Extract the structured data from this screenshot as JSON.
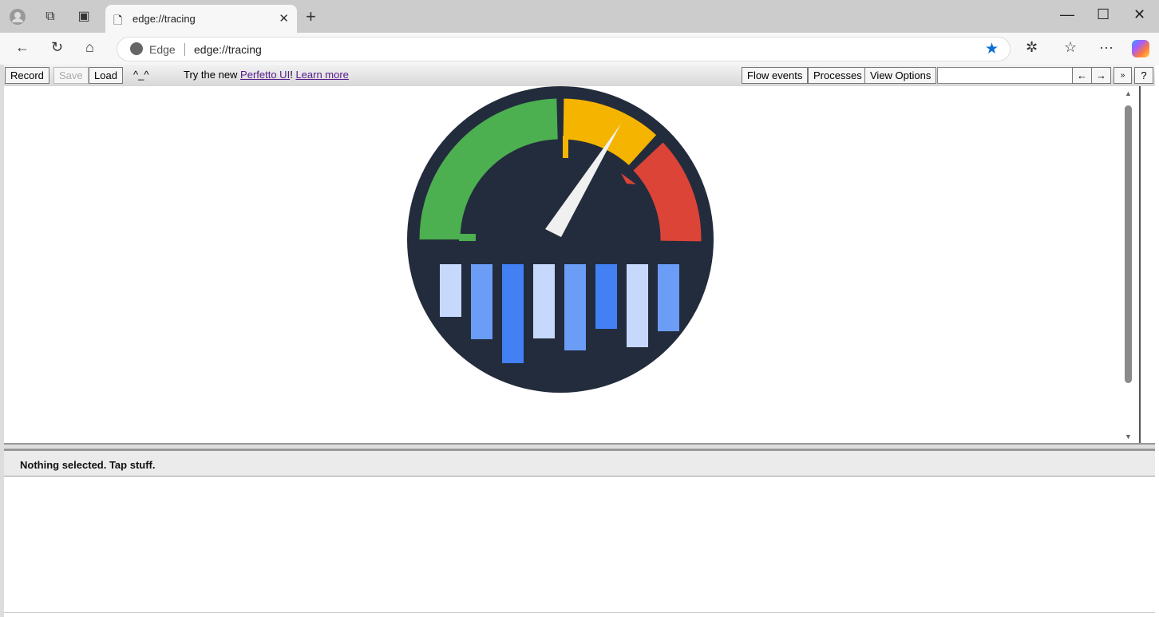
{
  "browser": {
    "tab_title": "edge://tracing",
    "omnibox_label": "Edge",
    "url": "edge://tracing",
    "icons": [
      "profile-icon",
      "workspaces-icon",
      "tab-actions-icon",
      "page-icon",
      "close-tab-icon",
      "new-tab-icon",
      "minimize-icon",
      "maximize-icon",
      "close-window-icon",
      "back-icon",
      "refresh-icon",
      "home-icon",
      "favorite-star-icon",
      "extensions-icon",
      "favorites-icon",
      "more-icon",
      "copilot-icon"
    ]
  },
  "toolbar": {
    "record": "Record",
    "save": "Save",
    "load": "Load",
    "face": "^_^",
    "promo_prefix": "Try the new ",
    "perfetto_link": "Perfetto UI",
    "promo_bang": "!",
    "learn_more": "Learn more",
    "flow_events": "Flow events",
    "processes": "Processes",
    "view_options": "View Options",
    "search_value": "",
    "prev": "←",
    "next": "→",
    "more": "»",
    "help": "?"
  },
  "details": {
    "status": "Nothing selected. Tap stuff."
  },
  "colors": {
    "logo_bg": "#232c3d",
    "green": "#4caf50",
    "yellow": "#f4b400",
    "red": "#db4437",
    "bar_light": "#c6d8fc",
    "bar_mid": "#6b9cf6",
    "bar_dark": "#4280f4",
    "link": "#551a8b"
  }
}
